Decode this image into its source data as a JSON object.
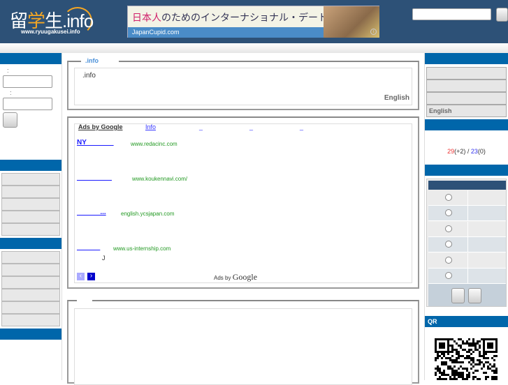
{
  "header": {
    "logo_main": "留学生",
    "logo_accent": "学",
    "logo_suffix": ".info",
    "logo_url": "www.ryuugakusei.info",
    "banner": {
      "headline_accent": "日本人",
      "headline": "のためのインターナショナル・デート・サイト!",
      "site": "JapanCupid.com",
      "info_icon": "i"
    },
    "search_placeholder": ""
  },
  "left": {
    "login": {
      "label1": ":",
      "label2": ":"
    }
  },
  "center": {
    "box1": {
      "legend": ".info",
      "text": ".info",
      "english_link": "English"
    },
    "ads": {
      "header": "Ads by Google",
      "info_link": "Info",
      "nav_links": [
        "_",
        "_",
        "_"
      ],
      "items": [
        {
          "title": "NY              ",
          "url": "www.redacinc.com"
        },
        {
          "title": "                  ",
          "url": "www.koukennavi.com/"
        },
        {
          "title": "            ...",
          "url": "english.ycsjapan.com"
        },
        {
          "title": "            ",
          "url": "www.us-internship.com"
        }
      ],
      "extra": "J",
      "footer_prefix": "Ads by",
      "footer_brand": "Google",
      "prev": "‹",
      "next": "›"
    }
  },
  "right": {
    "menu_last": "English",
    "stats": {
      "a": "29",
      "a_delta": "(+2)",
      "sep": " / ",
      "b": "23",
      "b_delta": "(0)"
    },
    "qr_title": "QR"
  },
  "colors": {
    "header": "#2d5177",
    "bar": "#0066aa"
  }
}
